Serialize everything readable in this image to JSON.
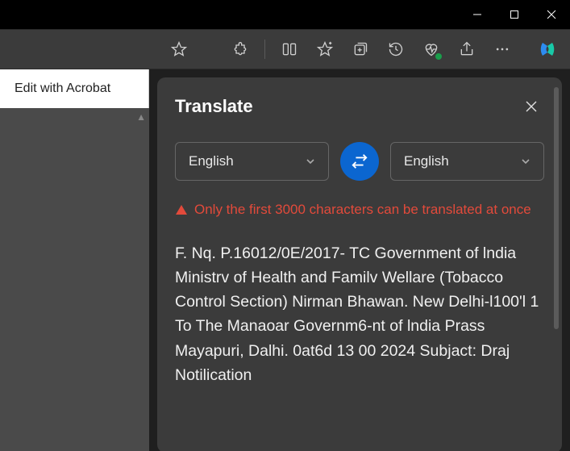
{
  "window": {
    "minimize_icon": "minimize",
    "maximize_icon": "maximize",
    "close_icon": "close"
  },
  "toolbar": {
    "favorite_icon": "star",
    "extensions_icon": "puzzle",
    "split_icon": "split-screen",
    "favorites_icon": "star-plus",
    "collections_icon": "collection-add",
    "history_icon": "history",
    "performance_icon": "heart-pulse",
    "share_icon": "share",
    "more_icon": "ellipsis",
    "copilot_icon": "copilot"
  },
  "left_panel": {
    "acrobat_label": "Edit with Acrobat"
  },
  "translate_panel": {
    "title": "Translate",
    "close_icon": "close",
    "source_language": "English",
    "target_language": "English",
    "swap_icon": "swap",
    "warning_message": "Only the first 3000 characters can be translated at once",
    "body_text": "F. Nq. P.16012/0E/2017- TC Government of lndia Ministrv of Health and Familv Wellare (Tobacco Control Section) Nirman Bhawan. New Delhi-l100'l 1 To The Manaoar Governm6-nt of lndia Prass Mayapuri, Dalhi. 0at6d 13 00 2024 Subjact: Draj Notilication"
  }
}
